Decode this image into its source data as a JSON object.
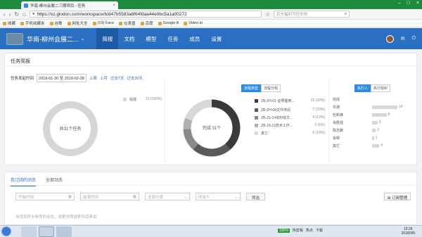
{
  "browser": {
    "tab_title": "华南-柳州会展二三期项目 - 任务",
    "url": "https://xz.glodon.com/workspace/b/d47b5583abf64fdaa44e0bc5a1a00272",
    "search_text": "京东福利节任你领"
  },
  "bookmarks": [
    "收藏",
    "手机收藏夹",
    "谷歌",
    "网址大全",
    "(19) Face",
    "仪表盘",
    "百度",
    "Google A",
    "Video to"
  ],
  "header": {
    "project_name": "华南-柳州会展二...",
    "nav": [
      "简报",
      "文档",
      "模型",
      "任务",
      "成员",
      "设置"
    ],
    "active_nav": "简报"
  },
  "briefing": {
    "title": "任务简报",
    "date_label": "任务发起时间",
    "date_range": "2018-01-30 至 2018-02-28",
    "quick_links": [
      "上周",
      "上月",
      "过去7天",
      "过去30天"
    ],
    "donut1": {
      "center_label": "共31个任务",
      "legend": "完成",
      "legend_value": "31 (100%)",
      "color": "#d6d6d6"
    },
    "donut2": {
      "center_label": "完成 31个",
      "tabs": [
        "流程类型",
        "流程分组"
      ],
      "active_tab": "流程类型",
      "items": [
        {
          "label": "ZB-ZH-01 证照催用...",
          "value": "12 (39%)",
          "color": "#3a3a3a"
        },
        {
          "label": "ZB-ZH-04文件传阅",
          "value": "7 (23%)",
          "color": "#5a5a5a"
        },
        {
          "label": "ZB-JS-14资料收文...",
          "value": "4 (13%)",
          "color": "#8a8a8a"
        },
        {
          "label": "ZB-JS-11技术工作...",
          "value": "2 (6%)",
          "color": "#b0b0b0"
        },
        {
          "label": "其它",
          "value": "6 (19%)",
          "color": "#d8d8d8"
        }
      ]
    },
    "people": {
      "tabs": [
        "执行人",
        "执行组织"
      ],
      "active_tab": "执行人",
      "header": "完成",
      "rows": [
        {
          "name": "许通",
          "value": 14
        },
        {
          "name": "杜新峰",
          "value": 8
        },
        {
          "name": "肖胜强",
          "value": 3
        },
        {
          "name": "陈志鹏",
          "value": 2
        },
        {
          "name": "肖辉",
          "value": 1
        },
        {
          "name": "其它",
          "value": 4
        }
      ]
    }
  },
  "activity": {
    "tabs": [
      "我订阅的动态",
      "全部动态"
    ],
    "active_tab": "我订阅的动态",
    "start_placeholder": "开始时间",
    "end_placeholder": "结束时间",
    "category": "全部分类",
    "owner": "所有人",
    "filter_btn": "筛选",
    "subscribe_btn": "订阅管理",
    "hint": "未找到符合条件的动态，请更改筛选条件后再试"
  },
  "taskbar": {
    "percent": "100%",
    "tray_items": [
      "快剪辑",
      "热点",
      "下载"
    ],
    "time": "15:25",
    "date": "2018/3/5"
  }
}
